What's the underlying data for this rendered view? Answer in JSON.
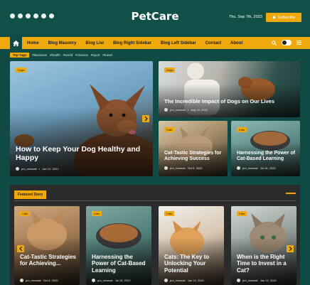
{
  "brand": "PetCare",
  "date": "Thu. Sep 7th, 2023",
  "subscribe_label": "Subscribe",
  "social_icons": [
    "facebook-icon",
    "twitter-icon",
    "linkedin-icon",
    "youtube-icon",
    "pinterest-icon",
    "telegram-icon"
  ],
  "nav": {
    "items": [
      "Home",
      "Blog Masonry",
      "Blog List",
      "Blog Right Sidebar",
      "Blog Left Sidebar",
      "Contact",
      "About"
    ]
  },
  "tags": {
    "label": "Top Tags",
    "items": [
      "#Business",
      "#health",
      "#world",
      "#closeos",
      "#sport",
      "#travel"
    ]
  },
  "hero": {
    "category": "Dogs",
    "title": "How to Keep Your Dog Healthy and Happy",
    "author": "pro_newsair",
    "date": "Jan 12, 2021"
  },
  "side_top": {
    "category": "Dogs",
    "title": "The Incredible Impact of Dogs on Our Lives",
    "author": "pro_newsair",
    "date": "Aug 18, 2022"
  },
  "side_left": {
    "category": "Cats",
    "title": "Cat-Tastic Strategies for Achieving Success",
    "author": "pro_newsair",
    "date": "Oct 5, 2020"
  },
  "side_right": {
    "category": "Cats",
    "title": "Harnessing the Power of Cat-Based Learning",
    "author": "pro_newsair",
    "date": "Jul 16, 2022"
  },
  "featured": {
    "title": "Featured Story",
    "cards": [
      {
        "category": "Cats",
        "title": "Cat-Tastic Strategies for Achieving...",
        "author": "pro_newsair",
        "date": "Oct 5, 2020"
      },
      {
        "category": "Cats",
        "title": "Harnessing the Power of Cat-Based Learning",
        "author": "pro_newsair",
        "date": "Jul 16, 2022"
      },
      {
        "category": "Cats",
        "title": "Cats: The Key to Unlocking Your Potential",
        "author": "pro_newsair",
        "date": "Jan 12, 2021"
      },
      {
        "category": "Cats",
        "title": "When is the Right Time to Invest in a Cat?",
        "author": "pro_newsair",
        "date": "Jan 12, 2021"
      }
    ]
  },
  "colors": {
    "accent": "#f0a90d",
    "background": "#0f4a44",
    "dark_panel": "#2b2b2b"
  }
}
